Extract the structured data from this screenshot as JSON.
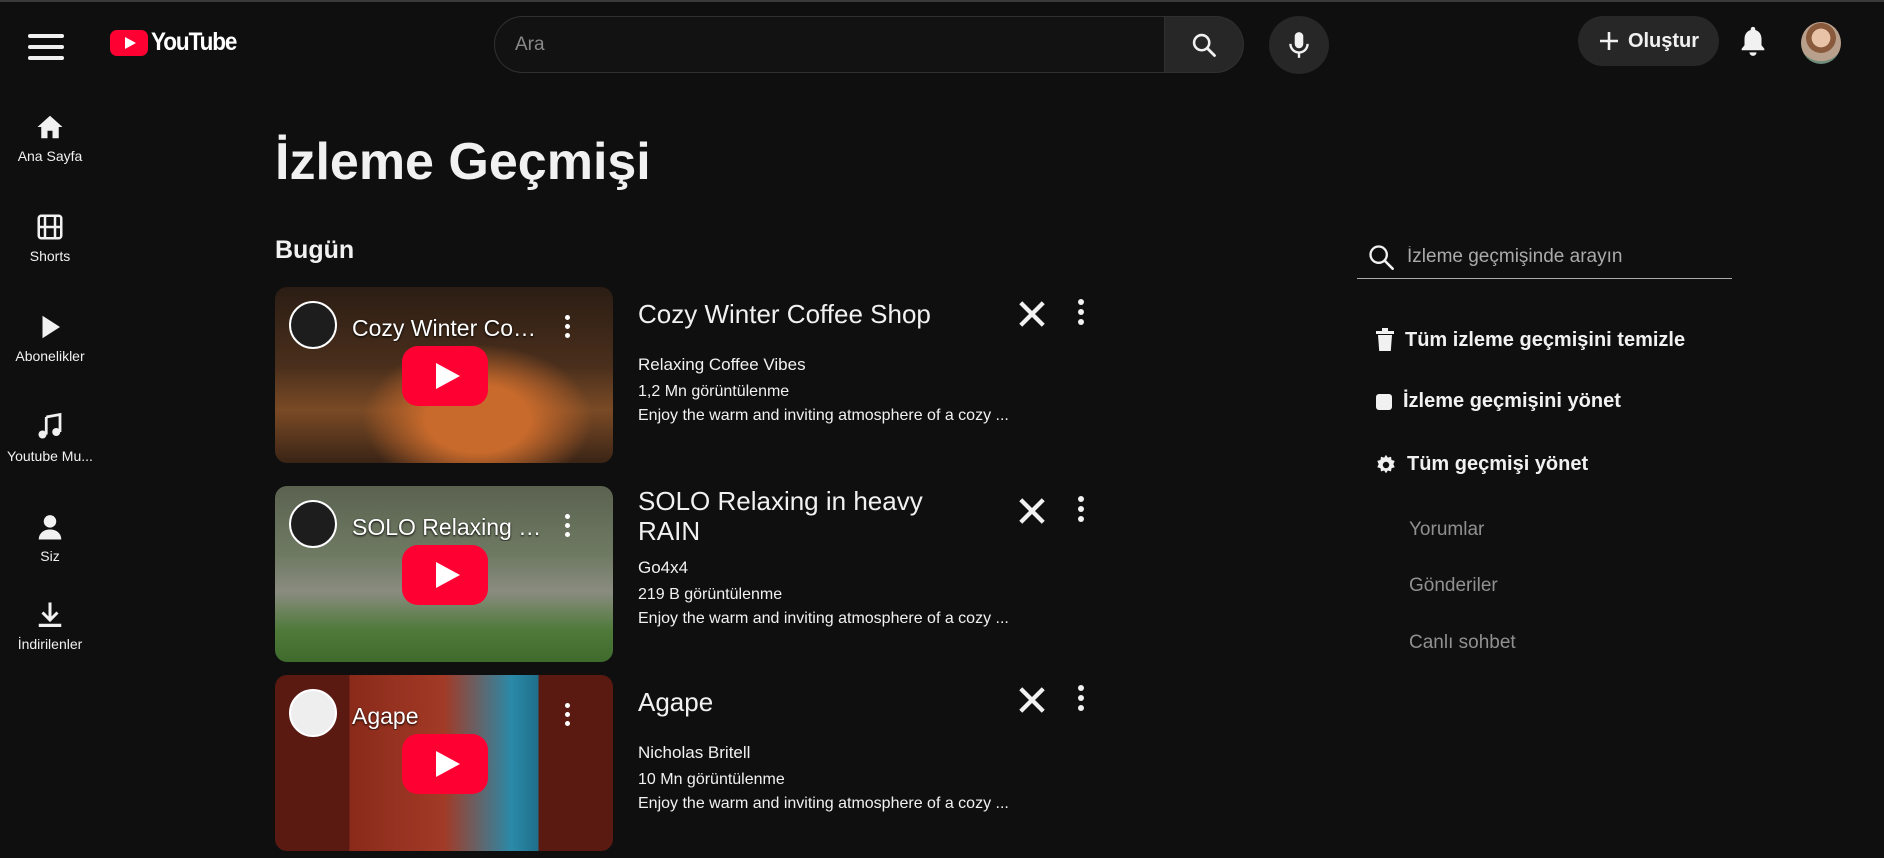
{
  "header": {
    "logo_text": "YouTube",
    "search_placeholder": "Ara",
    "create_label": "Oluştur"
  },
  "sidebar": {
    "items": [
      {
        "label": "Ana Sayfa",
        "icon": "home-icon"
      },
      {
        "label": "Shorts",
        "icon": "shorts-icon"
      },
      {
        "label": "Abonelikler",
        "icon": "subscriptions-icon"
      },
      {
        "label": "Youtube Mu...",
        "icon": "music-icon"
      },
      {
        "label": "Siz",
        "icon": "user-icon"
      },
      {
        "label": "İndirilenler",
        "icon": "download-icon"
      }
    ]
  },
  "main": {
    "page_title": "İzleme Geçmişi",
    "section_title": "Bugün",
    "videos": [
      {
        "title": "Cozy Winter Coffee Shop",
        "thumb_title": "Cozy Winter Coff...",
        "channel": "Relaxing Coffee Vibes",
        "views": "1,2 Mn görüntülenme",
        "description": "Enjoy the warm and inviting atmosphere of a cozy ..."
      },
      {
        "title": "SOLO Relaxing in heavy RAIN",
        "thumb_title": "SOLO Relaxing in...",
        "channel": "Go4x4",
        "views": "219 B görüntülenme",
        "description": "Enjoy the warm and inviting atmosphere of a cozy ..."
      },
      {
        "title": "Agape",
        "thumb_title": "Agape",
        "channel": "Nicholas Britell",
        "views": "10 Mn görüntülenme",
        "description": "Enjoy the warm and inviting atmosphere of a cozy ..."
      }
    ]
  },
  "right_panel": {
    "search_placeholder": "İzleme geçmişinde arayın",
    "actions": [
      {
        "label": "Tüm izleme geçmişini temizle",
        "icon": "trash-icon"
      },
      {
        "label": "İzleme geçmişini yönet",
        "icon": "stop-icon"
      },
      {
        "label": "Tüm geçmişi yönet",
        "icon": "gear-icon"
      }
    ],
    "sub_items": [
      "Yorumlar",
      "Gönderiler",
      "Canlı sohbet"
    ]
  },
  "colors": {
    "background": "#0f0f0f",
    "brand_red": "#ff0033",
    "text": "#f1f1f1",
    "secondary_text": "#909090"
  }
}
